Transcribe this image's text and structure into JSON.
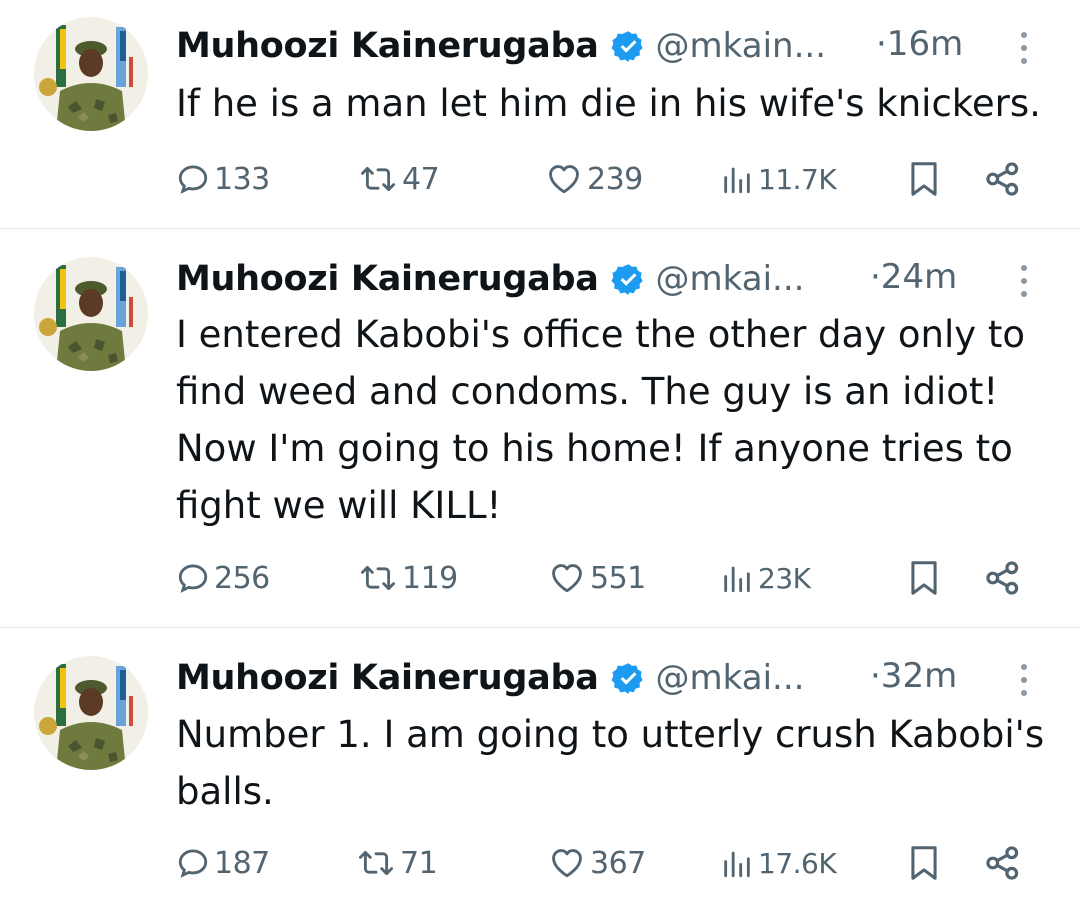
{
  "tweets": [
    {
      "author": "Muhoozi Kainerugaba",
      "handle": "@mkain...",
      "time": "·16m",
      "text": "If he is a man let him die in his wife's knickers.",
      "replies": "133",
      "reposts": "47",
      "likes": "239",
      "views": "11.7K"
    },
    {
      "author": "Muhoozi Kainerugaba",
      "handle": "@mkai...",
      "time": "·24m",
      "text": "I entered Kabobi's office the other day only to\nfind weed and condoms. The guy is an idiot!\nNow I'm going to his home! If anyone tries to\nfight we will KILL!",
      "replies": "256",
      "reposts": "119",
      "likes": "551",
      "views": "23K"
    },
    {
      "author": "Muhoozi Kainerugaba",
      "handle": "@mkai...",
      "time": "·32m",
      "text": "Number 1. I am going to utterly crush Kabobi's\nballs.",
      "replies": "187",
      "reposts": "71",
      "likes": "367",
      "views": "17.6K"
    }
  ],
  "icons": {
    "verified": "verified-badge-icon",
    "more": "more-options-icon",
    "reply": "reply-icon",
    "repost": "repost-icon",
    "like": "like-icon",
    "views": "views-icon",
    "bookmark": "bookmark-icon",
    "share": "share-icon"
  },
  "colors": {
    "verified": "#1d9bf0",
    "text": "#0f1419",
    "muted": "#536471"
  }
}
